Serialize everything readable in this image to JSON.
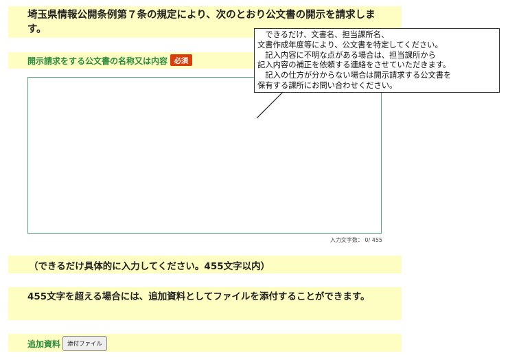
{
  "heading": "埼玉県情報公開条例第７条の規定により、次のとおり公文書の開示を請求します。",
  "request_field": {
    "label": "開示請求をする公文書の名称又は内容",
    "required_badge": "必須",
    "value": "",
    "counter": "入力文字数：  0/ 455"
  },
  "hint": "（できるだけ具体的に入力してください。455文字以内）",
  "note": "455文字を超える場合には、追加資料としてファイルを添付することができます。",
  "attachment": {
    "label": "追加資料",
    "button_label": "添付ファイル"
  },
  "tooltip": "　できるだけ、文書名、担当課所名、\n文書作成年度等により、公文書を特定してください。\n　記入内容に不明な点がある場合は、担当課所から\n記入内容の補正を依頼する連絡をさせていただきます。\n　記入の仕方が分からない場合は開示請求する公文書を\n保有する課所にお問い合わせください。"
}
